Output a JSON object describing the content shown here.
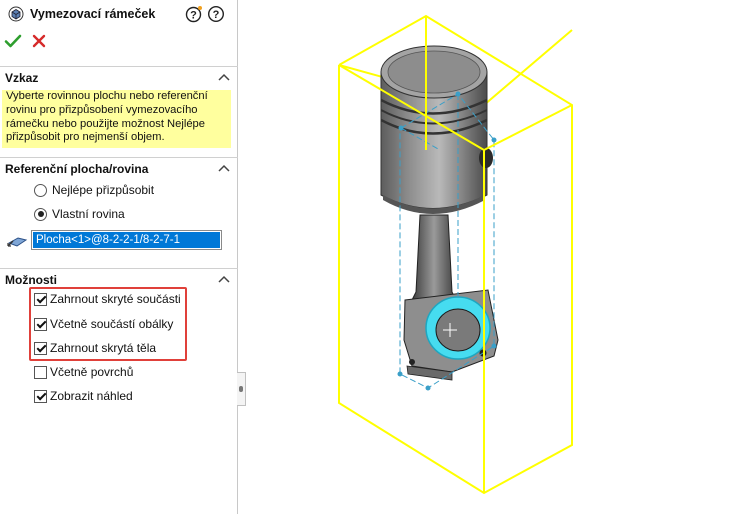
{
  "panel": {
    "title": "Vymezovací rámeček",
    "title_icon": "bounding-box-feature-icon",
    "help_icons": [
      "help-tips-icon",
      "help-icon"
    ],
    "ok_icon": "checkmark-icon",
    "cancel_icon": "close-icon"
  },
  "message": {
    "header": "Vzkaz",
    "text": "Vyberte rovinnou plochu nebo referenční rovinu pro přizpůsobení vymezovacího rámečku nebo použijte možnost Nejlépe přizpůsobit pro nejmenší objem."
  },
  "reference": {
    "header": "Referenční plocha/rovina",
    "options": [
      {
        "label": "Nejlépe přizpůsobit",
        "checked": false
      },
      {
        "label": "Vlastní rovina",
        "checked": true
      }
    ],
    "selection": "Plocha<1>@8-2-2-1/8-2-7-1",
    "selection_icon": "face-selection-icon"
  },
  "options": {
    "header": "Možnosti",
    "items": [
      {
        "label": "Zahrnout skryté součásti",
        "checked": true
      },
      {
        "label": "Včetně součástí obálky",
        "checked": true
      },
      {
        "label": "Zahrnout skrytá těla",
        "checked": true
      },
      {
        "label": "Včetně povrchů",
        "checked": false
      },
      {
        "label": "Zobrazit náhled",
        "checked": true
      }
    ]
  },
  "colors": {
    "bounding_box": "#ffff00",
    "selection_highlight": "#0078d7",
    "message_background": "#ffff9e",
    "face_highlight": "#3ad7f0",
    "callout_border": "#e0403a"
  }
}
